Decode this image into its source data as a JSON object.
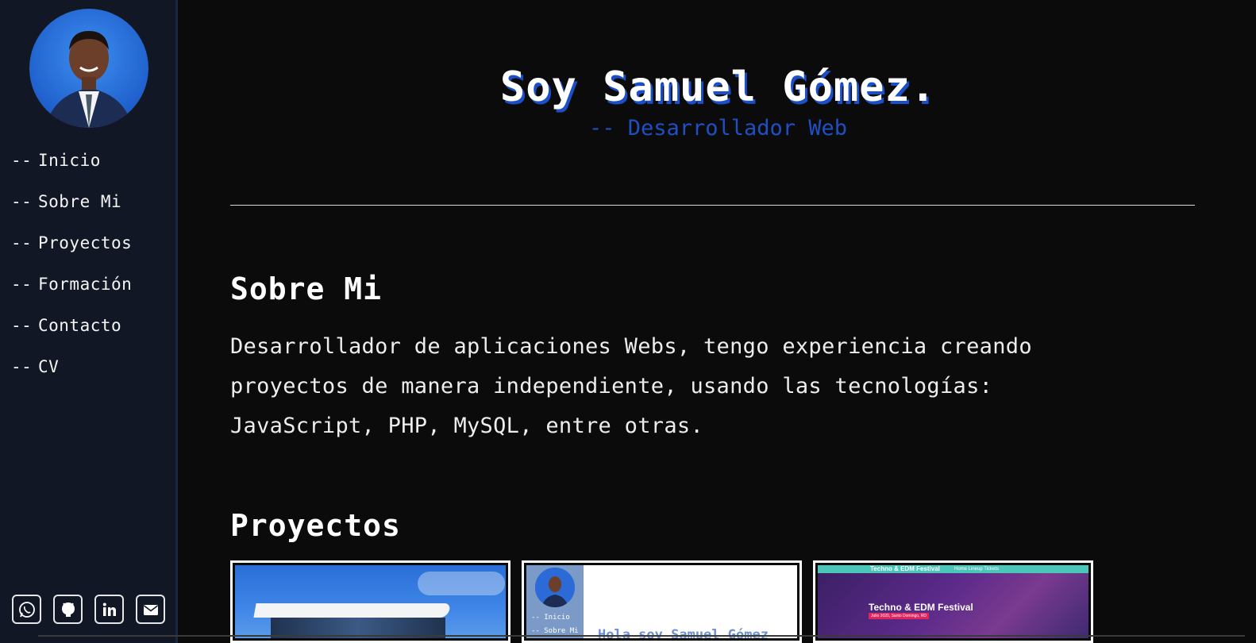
{
  "sidebar": {
    "nav_items": [
      {
        "dash": "--",
        "label": "Inicio"
      },
      {
        "dash": "--",
        "label": "Sobre Mi"
      },
      {
        "dash": "--",
        "label": "Proyectos"
      },
      {
        "dash": "--",
        "label": "Formación"
      },
      {
        "dash": "--",
        "label": "Contacto"
      },
      {
        "dash": "--",
        "label": "CV"
      }
    ],
    "social_icons": [
      "whatsapp-icon",
      "github-icon",
      "linkedin-icon",
      "mail-icon"
    ]
  },
  "hero": {
    "title": "Soy Samuel Gómez.",
    "subtitle": "-- Desarrollador Web"
  },
  "about": {
    "heading": "Sobre Mi",
    "text": "Desarrollador de aplicaciones Webs, tengo experiencia creando proyectos de manera independiente, usando las tecnologías: JavaScript, PHP, MySQL, entre otras."
  },
  "projects": {
    "heading": "Proyectos",
    "card2": {
      "nav": [
        "--  Inicio",
        "--  Sobre Mi"
      ],
      "title": "Hola soy Samuel Gómez"
    },
    "card3": {
      "bar_title": "Techno & EDM Festival",
      "bar_links": "Home   Lineup   Tickets",
      "title": "Techno & EDM Festival",
      "tag": "Julio 2020, Santo Domingo, RD"
    }
  },
  "colors": {
    "background": "#0b0b0c",
    "sidebar": "#111725",
    "accent_blue": "#1f4fc4"
  }
}
